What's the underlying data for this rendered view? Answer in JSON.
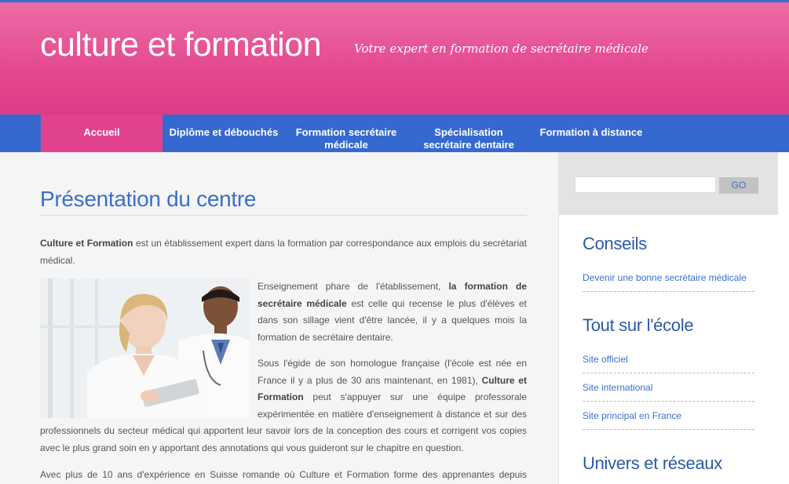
{
  "header": {
    "site_title": "culture et formation",
    "tagline": "Votre expert en formation de secrétaire médicale"
  },
  "nav": {
    "items": [
      {
        "label": "Accueil",
        "active": true
      },
      {
        "label": "Diplôme et débouchés",
        "active": false
      },
      {
        "label": "Formation secrétaire médicale",
        "active": false
      },
      {
        "label": "Spécialisation secrétaire dentaire",
        "active": false
      },
      {
        "label": "Formation à distance",
        "active": false
      }
    ]
  },
  "main": {
    "title": "Présentation du centre",
    "intro_bold": "Culture et Formation",
    "intro_rest": " est un établissement expert dans la formation par correspondance aux emplois du secrétariat médical.",
    "p2_a": "Enseignement phare de l'établissement, ",
    "p2_bold": "la formation de secrétaire médicale",
    "p2_b": " est celle qui recense le plus d'élèves et dans son sillage vient d'être lancée, il y a quelques mois la formation de secrétaire dentaire.",
    "p3_a": "Sous l'égide de son homologue française (l'école est née en France il y a plus de 30 ans maintenant, en 1981), ",
    "p3_bold": "Culture et Formation",
    "p3_b": " peut s'appuyer sur une équipe professorale expérimentée en matière d'enseignement à distance et sur des professionnels du secteur médical qui apportent leur savoir lors de la conception des cours et corrigent vos copies avec le plus grand soin en y apportant des annotations qui vous guideront sur le chapitre en question.",
    "p4": "Avec plus de 10 ans d'expérience en Suisse romande où Culture et Formation forme des apprenantes depuis"
  },
  "sidebar": {
    "search": {
      "placeholder": "",
      "button": "GO"
    },
    "sections": [
      {
        "title": "Conseils",
        "links": [
          "Devenir une bonne secrétaire médicale"
        ]
      },
      {
        "title": "Tout sur l'école",
        "links": [
          "Site officiel",
          "Site international",
          "Site principal en France"
        ]
      },
      {
        "title": "Univers et réseaux",
        "links": []
      }
    ]
  },
  "colors": {
    "header_pink": "#e4498f",
    "nav_blue": "#3569cf",
    "nav_active": "#e0428d",
    "link_blue": "#3a6fd0",
    "heading_blue": "#2c5aa8"
  }
}
